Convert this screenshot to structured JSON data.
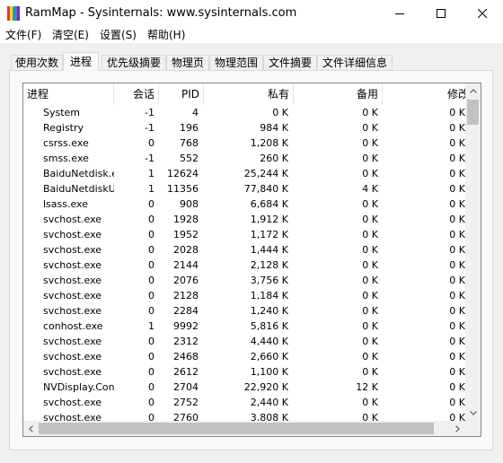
{
  "window": {
    "title": "RamMap - Sysinternals: www.sysinternals.com",
    "icon": "rammap-app-icon",
    "icon_colors": [
      "#e53935",
      "#fdd835",
      "#43a047",
      "#1e88e5",
      "#8e24aa"
    ]
  },
  "menu": [
    "文件(F)",
    "清空(E)",
    "设置(S)",
    "帮助(H)"
  ],
  "tabs": [
    "使用次数",
    "进程",
    "优先级摘要",
    "物理页",
    "物理范围",
    "文件摘要",
    "文件详细信息"
  ],
  "active_tab": "进程",
  "table": {
    "columns": [
      "进程",
      "会话",
      "PID",
      "私有",
      "备用",
      "修改"
    ],
    "rows": [
      [
        "System",
        "-1",
        "4",
        "0 K",
        "0 K",
        "0 K"
      ],
      [
        "Registry",
        "-1",
        "196",
        "984 K",
        "0 K",
        "0 K"
      ],
      [
        "csrss.exe",
        "0",
        "768",
        "1,208 K",
        "0 K",
        "0 K"
      ],
      [
        "smss.exe",
        "-1",
        "552",
        "260 K",
        "0 K",
        "0 K"
      ],
      [
        "BaiduNetdisk.e",
        "1",
        "12624",
        "25,244 K",
        "0 K",
        "0 K"
      ],
      [
        "BaiduNetdiskUn",
        "1",
        "11356",
        "77,840 K",
        "4 K",
        "0 K"
      ],
      [
        "lsass.exe",
        "0",
        "908",
        "6,684 K",
        "0 K",
        "0 K"
      ],
      [
        "svchost.exe",
        "0",
        "1928",
        "1,912 K",
        "0 K",
        "0 K"
      ],
      [
        "svchost.exe",
        "0",
        "1952",
        "1,172 K",
        "0 K",
        "0 K"
      ],
      [
        "svchost.exe",
        "0",
        "2028",
        "1,444 K",
        "0 K",
        "0 K"
      ],
      [
        "svchost.exe",
        "0",
        "2144",
        "2,128 K",
        "0 K",
        "0 K"
      ],
      [
        "svchost.exe",
        "0",
        "2076",
        "3,756 K",
        "0 K",
        "0 K"
      ],
      [
        "svchost.exe",
        "0",
        "2128",
        "1,184 K",
        "0 K",
        "0 K"
      ],
      [
        "svchost.exe",
        "0",
        "2284",
        "1,240 K",
        "0 K",
        "0 K"
      ],
      [
        "conhost.exe",
        "1",
        "9992",
        "5,816 K",
        "0 K",
        "0 K"
      ],
      [
        "svchost.exe",
        "0",
        "2312",
        "4,440 K",
        "0 K",
        "0 K"
      ],
      [
        "svchost.exe",
        "0",
        "2468",
        "2,660 K",
        "0 K",
        "0 K"
      ],
      [
        "svchost.exe",
        "0",
        "2612",
        "1,100 K",
        "0 K",
        "0 K"
      ],
      [
        "NVDisplay.Cont",
        "0",
        "2704",
        "22,920 K",
        "12 K",
        "0 K"
      ],
      [
        "svchost.exe",
        "0",
        "2752",
        "2,440 K",
        "0 K",
        "0 K"
      ],
      [
        "svchost.exe",
        "0",
        "2760",
        "3,808 K",
        "0 K",
        "0 K"
      ]
    ]
  },
  "scrollbars": {
    "vertical_position": 0,
    "horizontal_position": 0
  }
}
